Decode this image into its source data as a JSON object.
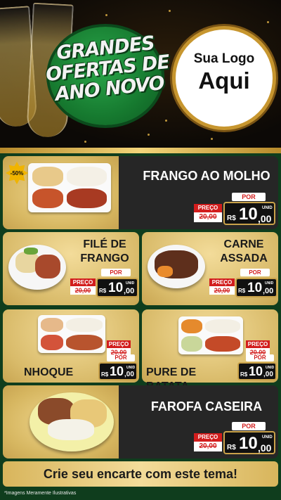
{
  "header": {
    "promo_title": "GRANDES OFERTAS DE ANO NOVO",
    "logo_line1": "Sua Logo",
    "logo_line2": "Aqui"
  },
  "labels": {
    "preco": "PREÇO",
    "por": "POR",
    "currency": "R$",
    "unid": "UNID"
  },
  "discount_badge": "-50%",
  "products": [
    {
      "name": "FRANGO AO MOLHO",
      "old_price": "20,00",
      "new_price_int": "10",
      "new_price_dec": ",00"
    },
    {
      "name": "FILÉ DE FRANGO",
      "name_line1": "FILÉ DE",
      "name_line2": "FRANGO",
      "old_price": "20,00",
      "new_price_int": "10",
      "new_price_dec": ",00"
    },
    {
      "name": "CARNE ASSADA",
      "name_line1": "CARNE",
      "name_line2": "ASSADA",
      "old_price": "20,00",
      "new_price_int": "10",
      "new_price_dec": ",00"
    },
    {
      "name": "NHOQUE",
      "old_price": "20,00",
      "new_price_int": "10",
      "new_price_dec": ",00"
    },
    {
      "name": "PURE DE BATATA",
      "old_price": "20,00",
      "new_price_int": "10",
      "new_price_dec": ",00"
    },
    {
      "name": "FAROFA CASEIRA",
      "old_price": "20,00",
      "new_price_int": "10",
      "new_price_dec": ",00"
    }
  ],
  "cta": "Crie seu encarte com este tema!",
  "footnote": "*Imagens Meramente Ilustrativas",
  "colors": {
    "green_bg": "#0f3d1d",
    "gold": "#d9bb6a",
    "red": "#d21d1d",
    "dark_card": "#262626"
  }
}
